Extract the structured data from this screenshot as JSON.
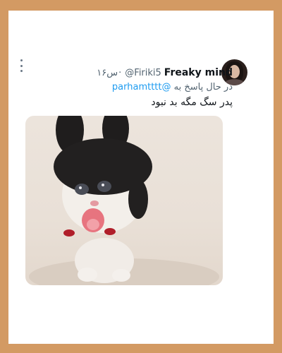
{
  "tweet": {
    "display_name": "Freaky mind",
    "handle": "@Firiki5",
    "separator": "·",
    "time": "۱۶س",
    "replying_prefix": "در حال پاسخ به",
    "replying_to": "@parhamtttt",
    "text": "پدر سگ مگه بد نبود"
  },
  "colors": {
    "frame": "#d39a63",
    "name": "#0f1419",
    "secondary": "#536471",
    "mention": "#1d9bf0"
  },
  "icons": {
    "more": "more-vertical-icon"
  }
}
